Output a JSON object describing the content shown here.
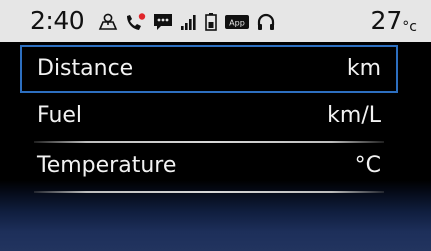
{
  "status_bar": {
    "time": "2:40",
    "temperature_value": "27",
    "temperature_unit": "°c",
    "icons": [
      "navigation-icon",
      "missed-call-icon",
      "message-icon",
      "signal-strength-icon",
      "battery-icon",
      "app-icon",
      "headphones-icon"
    ],
    "app_badge_label": "App"
  },
  "menu": {
    "items": [
      {
        "label": "Distance",
        "value": "km",
        "selected": true
      },
      {
        "label": "Fuel",
        "value": "km/L",
        "selected": false
      },
      {
        "label": "Temperature",
        "value": "°C",
        "selected": false
      }
    ]
  },
  "colors": {
    "status_bar_bg": "#e6e6e6",
    "selection_border": "#2d6fc0",
    "missed_call_red": "#e0262b",
    "screen_bg": "#000000",
    "bottom_gradient": "#22345f"
  }
}
